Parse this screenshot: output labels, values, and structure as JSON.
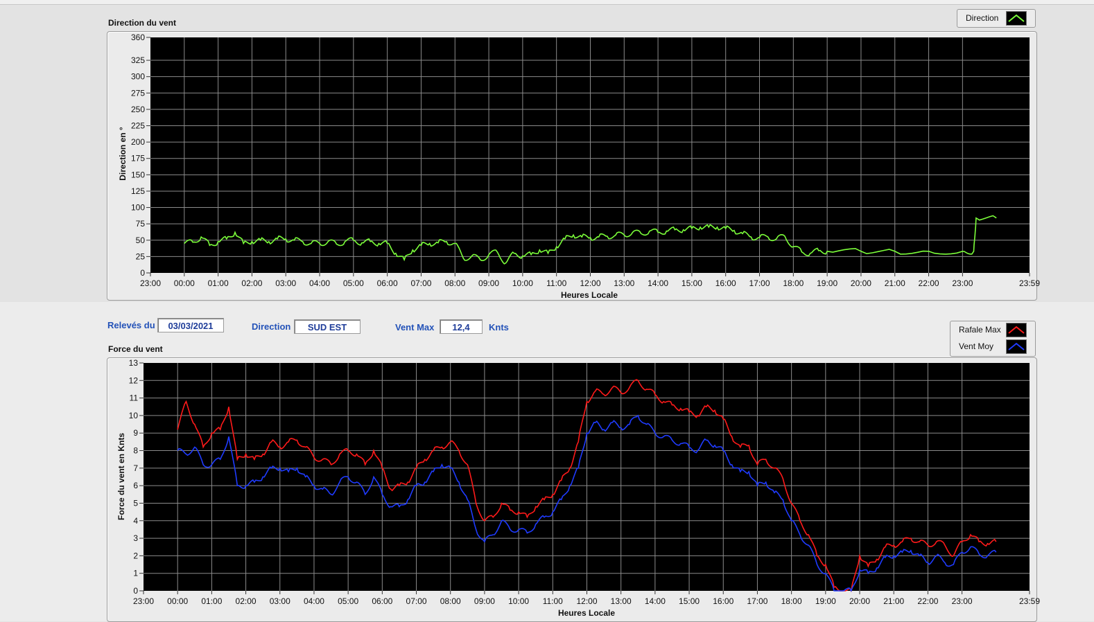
{
  "direction_panel": {
    "title": "Direction du vent",
    "legend": [
      {
        "label": "Direction",
        "color": "#7cff3a"
      }
    ]
  },
  "force_panel": {
    "title": "Force du vent",
    "legend": [
      {
        "label": "Rafale Max",
        "color": "#ff1a1a"
      },
      {
        "label": "Vent Moy",
        "color": "#1f3bff"
      }
    ]
  },
  "controls": {
    "releves_label": "Relevés du",
    "date_value": "03/03/2021",
    "direction_label": "Direction",
    "direction_value": "SUD EST",
    "ventmax_label": "Vent Max",
    "ventmax_value": "12,4",
    "unit_label": "Knts"
  },
  "chart_data": [
    {
      "type": "line",
      "title": "Direction du vent",
      "xlabel": "Heures Locale",
      "ylabel": "Direction en °",
      "x_ticks": [
        "23:00",
        "00:00",
        "01:00",
        "02:00",
        "03:00",
        "04:00",
        "05:00",
        "06:00",
        "07:00",
        "08:00",
        "09:00",
        "10:00",
        "11:00",
        "12:00",
        "13:00",
        "14:00",
        "15:00",
        "16:00",
        "17:00",
        "18:00",
        "19:00",
        "20:00",
        "21:00",
        "22:00",
        "23:00",
        "23:59"
      ],
      "y_ticks": [
        0,
        25,
        50,
        75,
        100,
        125,
        150,
        175,
        200,
        225,
        250,
        275,
        300,
        325,
        360
      ],
      "ylim": [
        0,
        360
      ],
      "xlim_hours": [
        -1,
        24.98
      ],
      "grid": true,
      "legend_position": "top-right",
      "series": [
        {
          "name": "Direction",
          "color": "#7cff3a",
          "x": [
            0,
            0.25,
            0.5,
            0.75,
            1,
            1.25,
            1.5,
            1.75,
            2,
            2.25,
            2.5,
            2.75,
            3,
            3.25,
            3.5,
            3.75,
            4,
            4.25,
            4.5,
            4.75,
            5,
            5.25,
            5.5,
            5.75,
            6,
            6.25,
            6.5,
            6.75,
            7,
            7.25,
            7.5,
            7.75,
            8,
            8.25,
            8.5,
            8.75,
            9,
            9.25,
            9.5,
            9.75,
            10,
            10.25,
            10.5,
            10.75,
            11,
            11.25,
            11.5,
            11.75,
            12,
            12.25,
            12.5,
            12.75,
            13,
            13.25,
            13.5,
            13.75,
            14,
            14.25,
            14.5,
            14.75,
            15,
            15.25,
            15.5,
            15.75,
            16,
            16.25,
            16.5,
            16.75,
            17,
            17.25,
            17.5,
            17.75,
            18,
            18.25,
            18.5,
            18.75,
            19,
            20,
            21,
            22,
            23,
            23.33,
            23.4,
            24
          ],
          "values": [
            45,
            47,
            55,
            42,
            48,
            52,
            62,
            45,
            48,
            50,
            48,
            52,
            52,
            50,
            48,
            45,
            45,
            48,
            44,
            48,
            50,
            46,
            48,
            45,
            45,
            30,
            20,
            35,
            42,
            45,
            46,
            48,
            45,
            22,
            26,
            20,
            28,
            32,
            15,
            30,
            26,
            28,
            35,
            30,
            40,
            52,
            58,
            55,
            54,
            55,
            56,
            58,
            58,
            62,
            60,
            64,
            62,
            64,
            66,
            66,
            68,
            70,
            70,
            70,
            68,
            65,
            60,
            55,
            54,
            55,
            52,
            56,
            40,
            32,
            30,
            34,
            33,
            33,
            33,
            33,
            33,
            33,
            84,
            84
          ]
        }
      ]
    },
    {
      "type": "line",
      "title": "Force du vent",
      "xlabel": "Heures Locale",
      "ylabel": "Force du vent en Knts",
      "x_ticks": [
        "23:00",
        "00:00",
        "01:00",
        "02:00",
        "03:00",
        "04:00",
        "05:00",
        "06:00",
        "07:00",
        "08:00",
        "09:00",
        "10:00",
        "11:00",
        "12:00",
        "13:00",
        "14:00",
        "15:00",
        "16:00",
        "17:00",
        "18:00",
        "19:00",
        "20:00",
        "21:00",
        "22:00",
        "23:00",
        "23:59"
      ],
      "y_ticks": [
        0,
        1,
        2,
        3,
        4,
        5,
        6,
        7,
        8,
        9,
        10,
        11,
        12,
        13
      ],
      "ylim": [
        0,
        13
      ],
      "xlim_hours": [
        -1,
        24.98
      ],
      "grid": true,
      "legend_position": "top-right",
      "series": [
        {
          "name": "Rafale Max",
          "color": "#ff1a1a",
          "x": [
            0,
            0.25,
            0.5,
            0.75,
            1,
            1.25,
            1.5,
            1.75,
            2,
            2.25,
            2.5,
            2.75,
            3,
            3.25,
            3.5,
            3.75,
            4,
            4.25,
            4.5,
            4.75,
            5,
            5.25,
            5.5,
            5.75,
            6,
            6.25,
            6.5,
            6.75,
            7,
            7.25,
            7.5,
            7.75,
            8,
            8.25,
            8.5,
            8.75,
            9,
            9.25,
            9.5,
            9.75,
            10,
            10.25,
            10.5,
            10.75,
            11,
            11.25,
            11.5,
            11.75,
            12,
            12.25,
            12.5,
            12.75,
            13,
            13.25,
            13.5,
            13.75,
            14,
            14.25,
            14.5,
            14.75,
            15,
            15.25,
            15.5,
            15.75,
            16,
            16.25,
            16.5,
            16.75,
            17,
            17.25,
            17.5,
            17.75,
            18,
            18.25,
            18.5,
            18.75,
            19,
            19.25,
            19.5,
            19.75,
            20,
            20.25,
            20.5,
            20.75,
            21,
            21.25,
            21.5,
            21.75,
            22,
            22.25,
            22.5,
            22.75,
            23,
            23.25,
            23.5,
            23.75,
            24
          ],
          "values": [
            9.2,
            10.8,
            9.5,
            8.2,
            9,
            9.2,
            10.5,
            7.5,
            7.8,
            7.5,
            7.8,
            8.5,
            8.2,
            8.5,
            8.6,
            8.2,
            7.6,
            7.5,
            7.2,
            7.8,
            8,
            7.8,
            7.2,
            8,
            7,
            5.8,
            6,
            6.2,
            7,
            7.5,
            8,
            8.2,
            8.5,
            8,
            7.2,
            5,
            4,
            4.2,
            5,
            4.6,
            4.5,
            4.2,
            4.8,
            5.2,
            5.5,
            6.3,
            7,
            8.5,
            10.8,
            11.4,
            11.2,
            11.6,
            11.3,
            11.6,
            12,
            11.5,
            11.2,
            10.8,
            10.6,
            10.4,
            10.2,
            10,
            10.5,
            10.3,
            9.8,
            8.8,
            8.2,
            8.3,
            7.2,
            7.5,
            7,
            6.4,
            5,
            4,
            3.2,
            2,
            1.5,
            0.2,
            0,
            0,
            2,
            1.4,
            1.8,
            2.5,
            2.6,
            2.8,
            3,
            2.8,
            2.6,
            2.8,
            2.6,
            2,
            2.8,
            3.2,
            2.8,
            2.7,
            2.8
          ]
        },
        {
          "name": "Vent Moy",
          "color": "#1f3bff",
          "x": [
            0,
            0.25,
            0.5,
            0.75,
            1,
            1.25,
            1.5,
            1.75,
            2,
            2.25,
            2.5,
            2.75,
            3,
            3.25,
            3.5,
            3.75,
            4,
            4.25,
            4.5,
            4.75,
            5,
            5.25,
            5.5,
            5.75,
            6,
            6.25,
            6.5,
            6.75,
            7,
            7.25,
            7.5,
            7.75,
            8,
            8.25,
            8.5,
            8.75,
            9,
            9.25,
            9.5,
            9.75,
            10,
            10.25,
            10.5,
            10.75,
            11,
            11.25,
            11.5,
            11.75,
            12,
            12.25,
            12.5,
            12.75,
            13,
            13.25,
            13.5,
            13.75,
            14,
            14.25,
            14.5,
            14.75,
            15,
            15.25,
            15.5,
            15.75,
            16,
            16.25,
            16.5,
            16.75,
            17,
            17.25,
            17.5,
            17.75,
            18,
            18.25,
            18.5,
            18.75,
            19,
            19.25,
            19.5,
            19.75,
            20,
            20.25,
            20.5,
            20.75,
            21,
            21.25,
            21.5,
            21.75,
            22,
            22.25,
            22.5,
            22.75,
            23,
            23.25,
            23.5,
            23.75,
            24
          ],
          "values": [
            8,
            7.8,
            8.2,
            7.2,
            7.2,
            7.5,
            8.8,
            6,
            6,
            6.2,
            6.5,
            7,
            7,
            6.8,
            7,
            6.5,
            6,
            5.8,
            5.5,
            6.2,
            6.5,
            6.2,
            5.5,
            6.5,
            5.5,
            4.8,
            4.8,
            5.2,
            6,
            6.2,
            6.8,
            7.2,
            7,
            6.2,
            5.2,
            3.5,
            2.8,
            3.2,
            4,
            3.5,
            3.5,
            3.3,
            3.8,
            4.2,
            4.5,
            5.2,
            6,
            7,
            9,
            9.6,
            9.2,
            9.6,
            9.3,
            9.5,
            10,
            9.5,
            9,
            8.8,
            8.6,
            8.4,
            8.2,
            8,
            8.6,
            8.3,
            8,
            7.2,
            6.8,
            6.8,
            6,
            6.2,
            5.6,
            5.2,
            4,
            3.2,
            2.6,
            1.5,
            1,
            0,
            0,
            0,
            1.2,
            1,
            1.3,
            1.9,
            2,
            2.2,
            2.3,
            2,
            1.6,
            2,
            1.6,
            1.5,
            2.2,
            2.5,
            2.1,
            2,
            2.2
          ]
        }
      ]
    }
  ]
}
